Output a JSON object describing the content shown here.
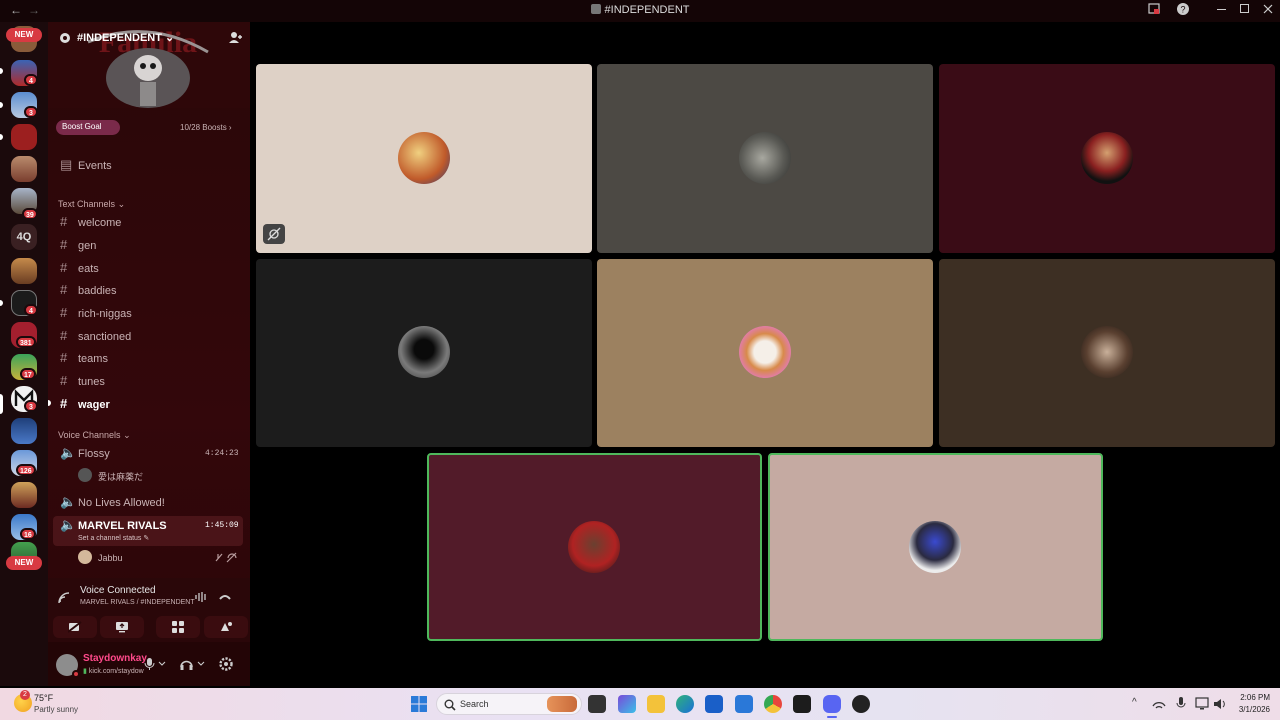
{
  "window": {
    "title": "#INDEPENDENT",
    "back_glyph": "←",
    "forward_glyph": "→"
  },
  "rail": {
    "new_top": "NEW",
    "new_bottom": "NEW",
    "text_server": "4Q",
    "badges": [
      "4",
      "3",
      "39",
      "4",
      "381",
      "17",
      "3",
      "126",
      "16"
    ]
  },
  "server": {
    "name": "#INDEPENDENT",
    "boost_goal": "Boost Goal",
    "boosts": "10/28 Boosts ›",
    "events": "Events"
  },
  "text_channels": {
    "header": "Text Channels",
    "items": [
      "welcome",
      "gen",
      "eats",
      "baddies",
      "rich-niggas",
      "sanctioned",
      "teams",
      "tunes",
      "wager"
    ]
  },
  "voice_channels": {
    "header": "Voice Channels",
    "flossy": {
      "name": "Flossy",
      "timer": "4:24:23",
      "member": "愛は麻薬だ"
    },
    "no_lives": {
      "name": "No Lives Allowed!"
    },
    "marvel": {
      "name": "MARVEL RIVALS",
      "timer": "1:45:09",
      "status": "Set a channel status",
      "member": "Jabbu"
    }
  },
  "voice_panel": {
    "status": "Voice Connected",
    "channel": "MARVEL RIVALS / #INDEPENDENT"
  },
  "user": {
    "name": "Staydownkay",
    "subtext": "kick.com/staydow"
  },
  "taskbar": {
    "weather_temp": "75°F",
    "weather_desc": "Partly sunny",
    "weather_badge": "2",
    "search_placeholder": "Search",
    "time": "2:06 PM",
    "date": "3/1/2026"
  },
  "tile_colors": [
    "#ded1c6",
    "#4c4944",
    "#3a0c16",
    "#1c1c1c",
    "#9c8160",
    "#3d2f23",
    "#521b29",
    "#c5aaa2"
  ],
  "accent_green": "#4fb85c",
  "badge_red": "#d83a42"
}
